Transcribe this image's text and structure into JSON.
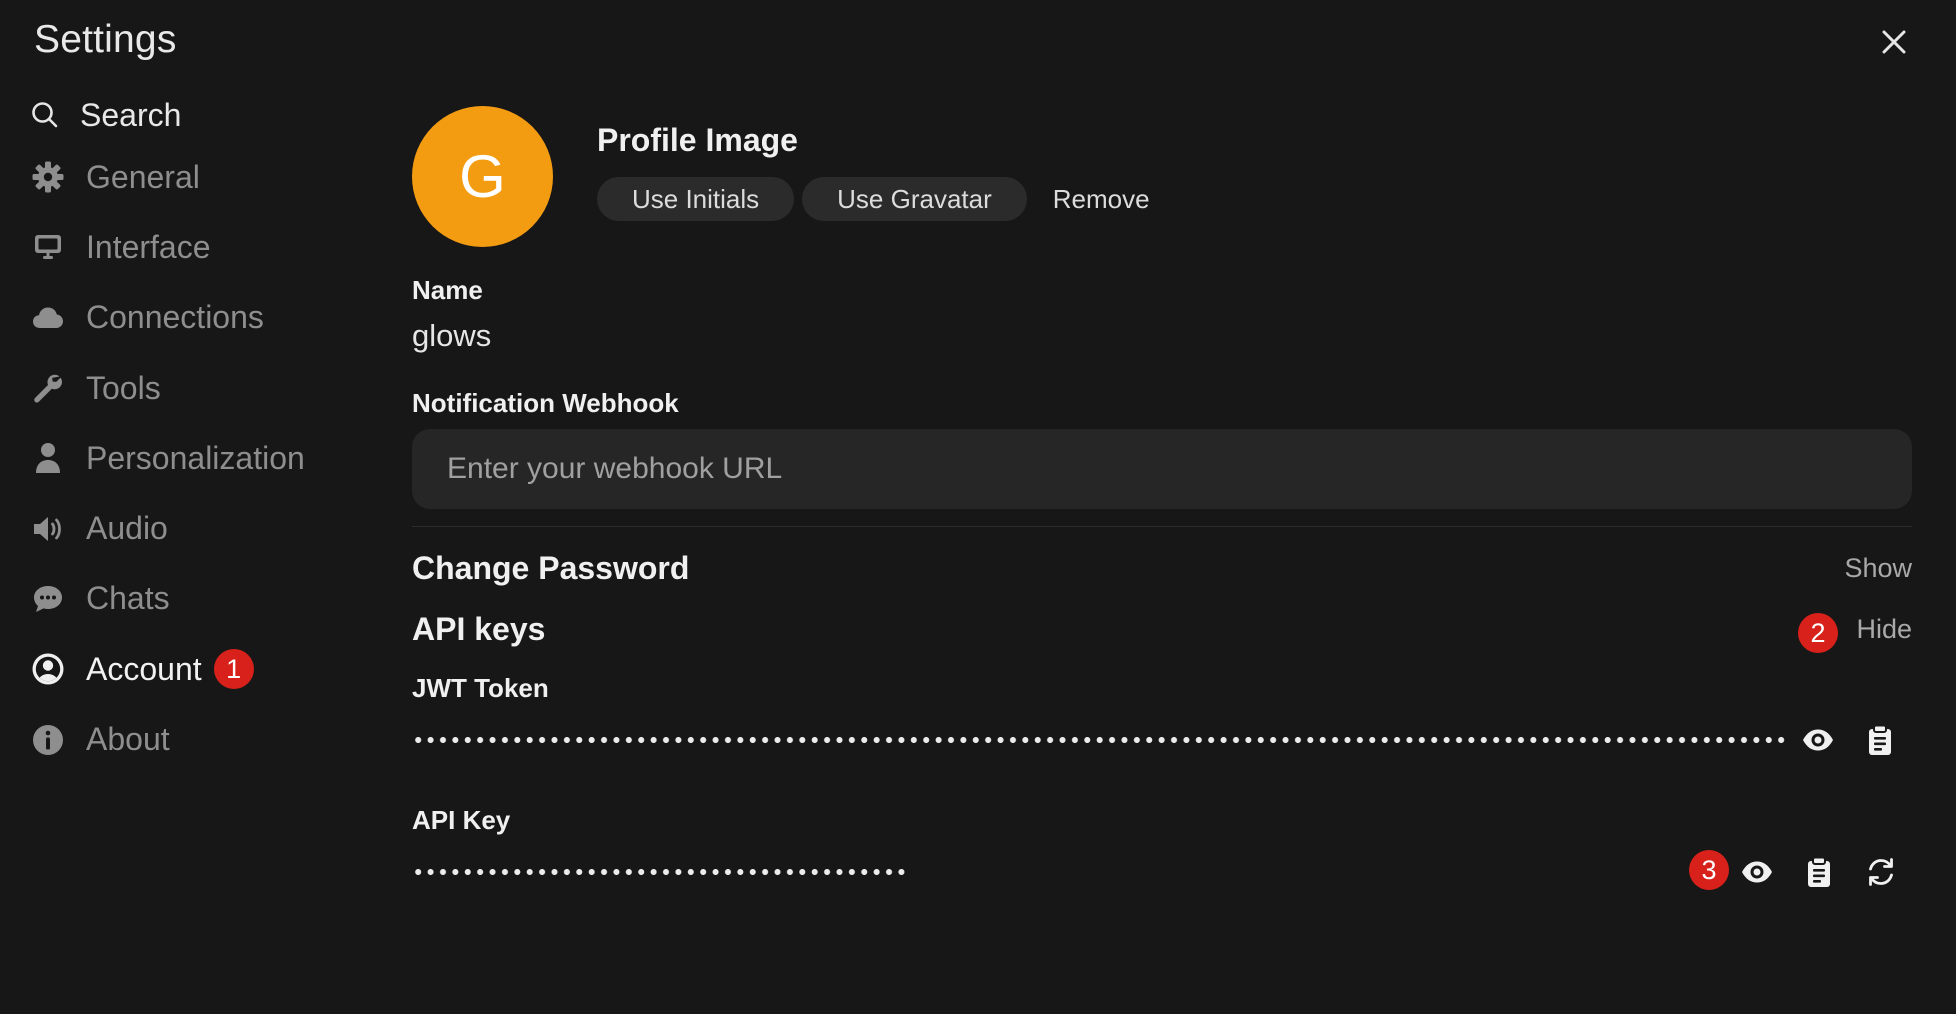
{
  "window": {
    "title": "Settings"
  },
  "sidebar": {
    "search_label": "Search",
    "items": [
      {
        "label": "General",
        "icon": "gear-icon"
      },
      {
        "label": "Interface",
        "icon": "monitor-icon"
      },
      {
        "label": "Connections",
        "icon": "cloud-icon"
      },
      {
        "label": "Tools",
        "icon": "wrench-icon"
      },
      {
        "label": "Personalization",
        "icon": "user-icon"
      },
      {
        "label": "Audio",
        "icon": "speaker-icon"
      },
      {
        "label": "Chats",
        "icon": "chat-bubble-icon"
      },
      {
        "label": "Account",
        "icon": "user-circle-icon",
        "active": true,
        "badge": "1"
      },
      {
        "label": "About",
        "icon": "info-icon"
      }
    ]
  },
  "profile": {
    "avatar_initial": "G",
    "avatar_color": "#f39c12",
    "title": "Profile Image",
    "use_initials_label": "Use Initials",
    "use_gravatar_label": "Use Gravatar",
    "remove_label": "Remove"
  },
  "name_field": {
    "label": "Name",
    "value": "glows"
  },
  "webhook": {
    "label": "Notification Webhook",
    "placeholder": "Enter your webhook URL",
    "value": ""
  },
  "change_password": {
    "title": "Change Password",
    "toggle_label": "Show"
  },
  "api_keys": {
    "title": "API keys",
    "toggle_label": "Hide",
    "badge": "2",
    "jwt": {
      "label": "JWT Token"
    },
    "api_key": {
      "label": "API Key",
      "badge": "3"
    }
  },
  "colors": {
    "background": "#171717",
    "badge": "#d8211a",
    "input_bg": "#262626"
  }
}
